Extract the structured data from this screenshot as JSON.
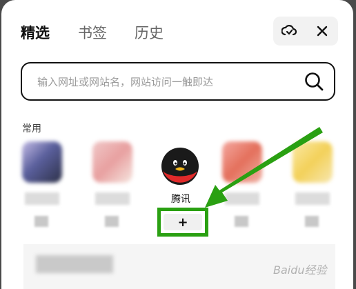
{
  "tabs": [
    {
      "label": "精选",
      "active": true
    },
    {
      "label": "书签",
      "active": false
    },
    {
      "label": "历史",
      "active": false
    }
  ],
  "actions": {
    "sync_icon": "cloud-sync-icon",
    "close_icon": "close-icon"
  },
  "search": {
    "placeholder": "输入网址或网站名，网站访问一触即达",
    "icon": "search-icon"
  },
  "section": {
    "title": "常用"
  },
  "sites": [
    {
      "name": "",
      "blurred": true,
      "color": "#5a5f9c"
    },
    {
      "name": "",
      "blurred": true,
      "color": "#e8b8b8"
    },
    {
      "name": "腾讯",
      "blurred": false,
      "icon": "qq-penguin-icon"
    },
    {
      "name": "",
      "blurred": true,
      "color": "#e4705c"
    },
    {
      "name": "",
      "blurred": true,
      "color": "#f3d15a"
    }
  ],
  "add_button": {
    "label": "+"
  },
  "annotation": {
    "highlight_color": "#2aa012",
    "arrow_color": "#2aa012"
  },
  "watermark": {
    "text": "Baidu经验"
  }
}
